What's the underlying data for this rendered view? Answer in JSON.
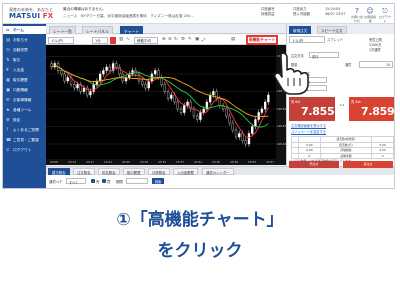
{
  "header": {
    "logo_tagline": "資産の未来を、あなたと",
    "logo_text": "MATSUI",
    "logo_fx": "FX",
    "news_line1": "最近の情報はありません。",
    "news_line2": "ニュース　NYダウ一日高、米中通商協議進展を期待　ディズニー株は反落 200...",
    "account1_label": "口座番号",
    "account1_value": "評価損益",
    "account2_label": "口座余力",
    "account2_value": "受入可能額",
    "time": "15:24:05",
    "datetime": "06/07 23:57",
    "icons": [
      {
        "name": "help-icon",
        "glyph": "?",
        "label": "お問い合わせ"
      },
      {
        "name": "user-icon",
        "glyph": "☺",
        "label": "お客様情報"
      },
      {
        "name": "logout-icon",
        "glyph": "⎋",
        "label": "ログアウト"
      }
    ]
  },
  "sidebar": {
    "items": [
      {
        "icon": "⌂",
        "label": "ホーム",
        "active": true
      },
      {
        "icon": "▤",
        "label": "お知らせ"
      },
      {
        "icon": "◷",
        "label": "自動売買"
      },
      {
        "icon": "⇅",
        "label": "取引"
      },
      {
        "icon": "¥",
        "label": "入出金"
      },
      {
        "icon": "▦",
        "label": "取引履歴"
      },
      {
        "icon": "▣",
        "label": "口座情報"
      },
      {
        "icon": "✉",
        "label": "お客様情報"
      },
      {
        "icon": "★",
        "label": "各種ツール"
      },
      {
        "icon": "⚙",
        "label": "設定"
      },
      {
        "icon": "?",
        "label": "よくあるご質問"
      },
      {
        "icon": "☎",
        "label": "ご意見・ご要望"
      },
      {
        "icon": "⎋",
        "label": "ログアウト"
      }
    ]
  },
  "chart_tabs": [
    "レート一覧",
    "レートパネル",
    "チャート"
  ],
  "chart_tab_active": 2,
  "chart_toolbar": {
    "symbol": "ドル/円",
    "timeframe": "1分",
    "indicator": "移動平均",
    "advanced_button": "高機能チャート"
  },
  "chart": {
    "y_labels": [
      "108.65",
      "108.60",
      "108.55",
      "108.50",
      "108.45",
      "108.40"
    ],
    "x_labels": [
      "23:09",
      "23:13",
      "23:17",
      "23:21",
      "23:25",
      "23:29",
      "23:33",
      "23:37",
      "23:41",
      "23:45",
      "23:49",
      "23:53",
      "23:57"
    ],
    "candles": [
      108.62,
      108.63,
      108.61,
      108.6,
      108.58,
      108.59,
      108.57,
      108.56,
      108.57,
      108.55,
      108.56,
      108.54,
      108.55,
      108.57,
      108.58,
      108.6,
      108.61,
      108.62,
      108.61,
      108.63,
      108.62,
      108.6,
      108.58,
      108.59,
      108.6,
      108.61,
      108.6,
      108.58,
      108.57,
      108.56,
      108.58,
      108.6,
      108.61,
      108.59,
      108.57,
      108.55,
      108.53,
      108.54,
      108.52,
      108.5,
      108.49,
      108.51,
      108.52,
      108.5,
      108.48,
      108.47,
      108.49,
      108.5,
      108.52,
      108.54,
      108.55,
      108.53,
      108.51,
      108.5,
      108.48,
      108.46,
      108.44,
      108.42,
      108.43,
      108.41,
      108.4,
      108.43,
      108.45,
      108.47,
      108.49,
      108.5,
      108.52,
      108.54
    ],
    "ma_short_color": "#ff3b3b",
    "ma_mid_color": "#22cc44",
    "ma_long_color": "#f5a623"
  },
  "bottom_tabs": [
    "建玉照会",
    "注文照会",
    "約定照会",
    "取引履歴",
    "口座照会",
    "入出金履歴",
    "通貨カレンダー"
  ],
  "bottom_tab_active": 0,
  "filter": {
    "symbol_label": "通貨ペア",
    "symbol_value": "すべて",
    "check1": "売",
    "check2": "買",
    "period_label": "期間",
    "search_button": "検索"
  },
  "order_panel": {
    "tabs": [
      "新規注文",
      "スピード注文"
    ],
    "tab_active": 0,
    "symbol": "ドル/円",
    "spread_label": "スプレッド",
    "order_type_label": "注文方法",
    "order_type": "成行",
    "quantity_label": "数量",
    "quantity_unit": "通貨",
    "quantity": "10",
    "cap_label": "売買上限",
    "cap_value": "3,000万",
    "lot_label": "1万通貨",
    "settle_label": "決済同時発注",
    "settle_option1": "指値(OCO)",
    "settle_option2": "指値(IFD)",
    "sell_label": "売 Bid",
    "sell_price": "7.855",
    "buy_label": "買 Ask",
    "buy_price": "7.859",
    "spread_value": "0.4",
    "link1": "注文確認画面を表示する",
    "link2": "スリッページを設定する",
    "grid": [
      [
        "",
        "",
        "建玉数(総通貨)",
        ""
      ],
      [
        "",
        "0.00",
        "建玉数(売)",
        "0.00"
      ],
      [
        "",
        "0.00",
        "評価損益",
        "0.00"
      ],
      [
        "",
        "0",
        "証拠金額",
        "0"
      ]
    ],
    "note": "※上記の数量には合計建玉数量を表示しています",
    "sell_order": "売注文",
    "buy_order": "買注文"
  },
  "caption": {
    "line1": "①「高機能チャート」",
    "line2": "をクリック"
  }
}
